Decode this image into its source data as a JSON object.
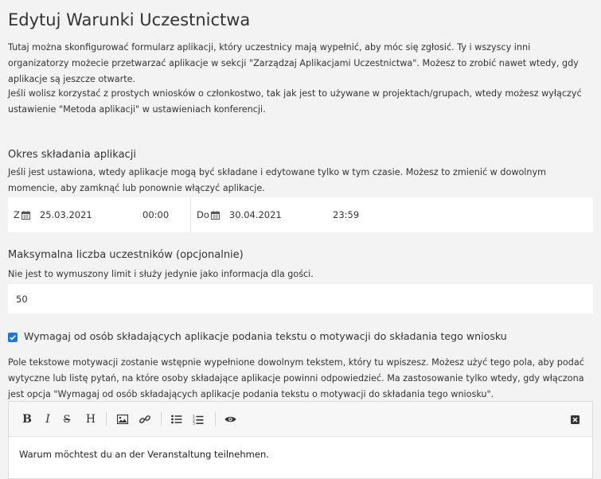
{
  "page": {
    "title": "Edytuj Warunki Uczestnictwa",
    "intro_1": "Tutaj można skonfigurować formularz aplikacji, który uczestnicy mają wypełnić, aby móc się zgłosić. Ty i wszyscy inni organizatorzy możecie przetwarzać aplikacje w sekcji \"Zarządzaj Aplikacjami Uczestnictwa\". Możesz to zrobić nawet wtedy, gdy aplikacje są jeszcze otwarte.",
    "intro_2": "Jeśli wolisz korzystać z prostych wniosków o członkostwo, tak jak jest to używane w projektach/grupach, wtedy możesz wyłączyć ustawienie \"Metoda aplikacji\" w ustawieniach konferencji."
  },
  "period": {
    "title": "Okres składania aplikacji",
    "help": "Jeśli jest ustawiona, wtedy aplikacje mogą być składane i edytowane tylko w tym czasie. Możesz to zmienić w dowolnym momencie, aby zamknąć lub ponownie włączyć aplikacje.",
    "from_label": "Z",
    "from_date": "25.03.2021",
    "from_time": "00:00",
    "to_label": "Do",
    "to_date": "30.04.2021",
    "to_time": "23:59"
  },
  "max_participants": {
    "title": "Maksymalna liczba uczestników (opcjonalnie)",
    "help": "Nie jest to wymuszony limit i służy jedynie jako informacja dla gości.",
    "value": "50"
  },
  "motivation": {
    "checked": true,
    "label": "Wymagaj od osób składających aplikacje podania tekstu o motywacji do składania tego wniosku",
    "help": "Pole tekstowe motywacji zostanie wstępnie wypełnione dowolnym tekstem, który tu wpiszesz. Możesz użyć tego pola, aby podać wytyczne lub listę pytań, na które osoby składające aplikacje powinni odpowiedzieć. Ma zastosowanie tylko wtedy, gdy włączona jest opcja \"Wymagaj od osób składających aplikacje podania tekstu o motywacji do składania tego wniosku\".",
    "editor_text": "Warum möchtest du an der Veranstaltung teilnehmen."
  },
  "toolbar": {
    "bold": "B",
    "italic": "I",
    "strike": "S",
    "heading": "H",
    "icons": [
      "image-icon",
      "link-icon",
      "bullet-list-icon",
      "numbered-list-icon",
      "preview-eye-icon",
      "fullscreen-close-icon"
    ]
  },
  "colors": {
    "checkbox": "#1a73e8",
    "background": "#f3f3f3"
  }
}
